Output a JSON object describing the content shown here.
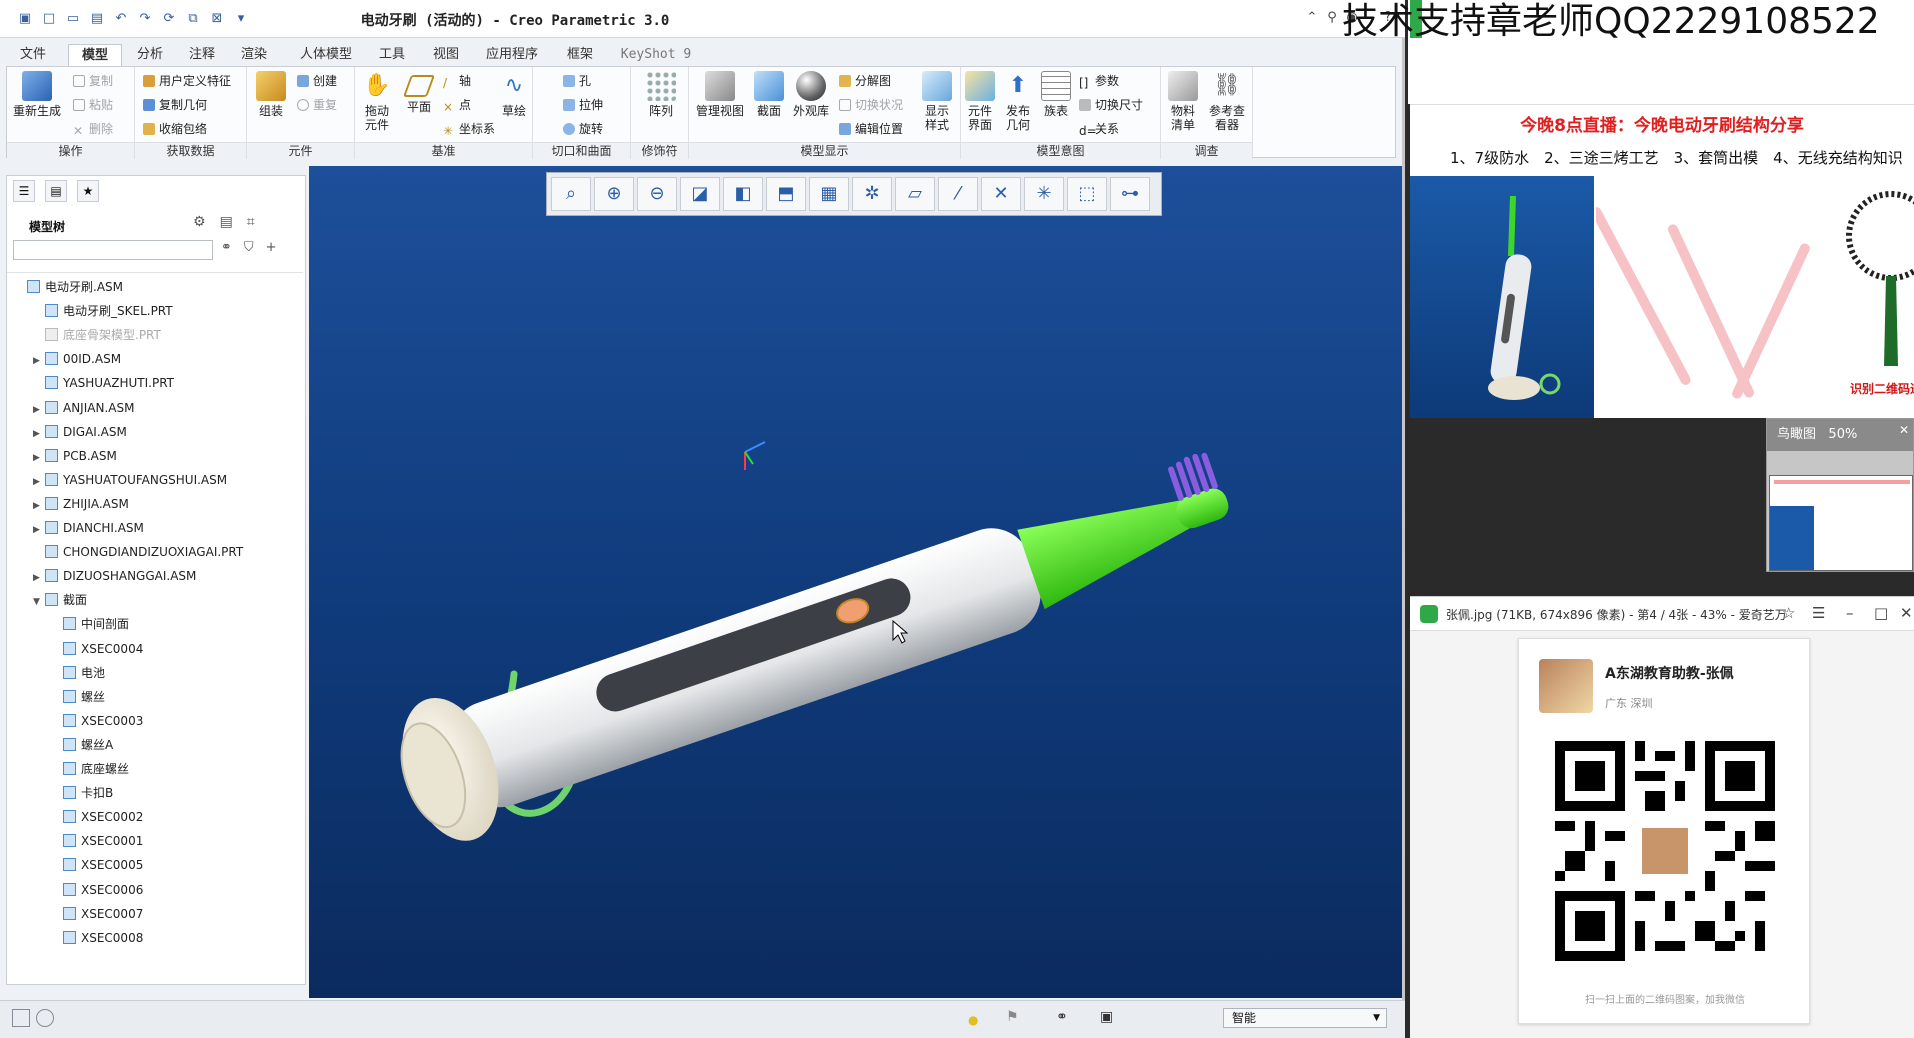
{
  "window": {
    "title": "电动牙刷 (活动的) - Creo Parametric 3.0"
  },
  "overlay": {
    "text": "技术支持章老师QQ2229108522"
  },
  "ribbon_tabs": [
    {
      "label": "文件"
    },
    {
      "label": "模型"
    },
    {
      "label": "分析"
    },
    {
      "label": "注释"
    },
    {
      "label": "渲染"
    },
    {
      "label": "人体模型"
    },
    {
      "label": "工具"
    },
    {
      "label": "视图"
    },
    {
      "label": "应用程序"
    },
    {
      "label": "框架"
    },
    {
      "label": "KeyShot 9"
    }
  ],
  "ribbon": {
    "operations": {
      "label": "操作",
      "regenerate": "重新生成",
      "copy": "复制",
      "paste": "粘贴",
      "delete": "删除"
    },
    "get_data": {
      "label": "获取数据",
      "udf": "用户定义特征",
      "copy_geom": "复制几何",
      "shrinkwrap": "收缩包络"
    },
    "component": {
      "label": "元件",
      "assemble": "组装",
      "create": "创建",
      "repeat": "重复"
    },
    "datum": {
      "label": "基准",
      "drag": "拖动元件",
      "plane": "平面",
      "axis": "轴",
      "point": "点",
      "csys": "坐标系",
      "sketch": "草绘"
    },
    "cut_surface": {
      "label": "切口和曲面",
      "hole": "孔",
      "extrude": "拉伸",
      "revolve": "旋转"
    },
    "modifiers": {
      "label": "修饰符",
      "pattern": "阵列"
    },
    "model_display": {
      "label": "模型显示",
      "manage_views": "管理视图",
      "section": "截面",
      "appearance": "外观库",
      "exploded": "分解图",
      "toggle_status": "切换状况",
      "edit_position": "编辑位置",
      "display_style": "显示样式"
    },
    "model_intent": {
      "label": "模型意图",
      "component_interface": "元件界面",
      "publish_geometry": "发布几何",
      "family_table": "族表",
      "parameters": "参数",
      "switch_dims": "切换尺寸",
      "relations": "关系"
    },
    "investigate": {
      "label": "调查",
      "bom": "物料清单",
      "reference_viewer": "参考查看器"
    }
  },
  "model_tree": {
    "header": "模型树",
    "nodes": [
      {
        "label": "电动牙刷.ASM",
        "level": 0,
        "toggle": "",
        "dim": false
      },
      {
        "label": "电动牙刷_SKEL.PRT",
        "level": 1,
        "toggle": "",
        "dim": false
      },
      {
        "label": "底座骨架模型.PRT",
        "level": 1,
        "toggle": "",
        "dim": true
      },
      {
        "label": "00ID.ASM",
        "level": 1,
        "toggle": "▶",
        "dim": false
      },
      {
        "label": "YASHUAZHUTI.PRT",
        "level": 1,
        "toggle": "",
        "dim": false
      },
      {
        "label": "ANJIAN.ASM",
        "level": 1,
        "toggle": "▶",
        "dim": false
      },
      {
        "label": "DIGAI.ASM",
        "level": 1,
        "toggle": "▶",
        "dim": false
      },
      {
        "label": "PCB.ASM",
        "level": 1,
        "toggle": "▶",
        "dim": false
      },
      {
        "label": "YASHUATOUFANGSHUI.ASM",
        "level": 1,
        "toggle": "▶",
        "dim": false
      },
      {
        "label": "ZHIJIA.ASM",
        "level": 1,
        "toggle": "▶",
        "dim": false
      },
      {
        "label": "DIANCHI.ASM",
        "level": 1,
        "toggle": "▶",
        "dim": false
      },
      {
        "label": "CHONGDIANDIZUOXIAGAI.PRT",
        "level": 1,
        "toggle": "",
        "dim": false
      },
      {
        "label": "DIZUOSHANGGAI.ASM",
        "level": 1,
        "toggle": "▶",
        "dim": false
      },
      {
        "label": "截面",
        "level": 1,
        "toggle": "▼",
        "dim": false
      },
      {
        "label": "中间剖面",
        "level": 2,
        "toggle": "",
        "dim": false
      },
      {
        "label": "XSEC0004",
        "level": 2,
        "toggle": "",
        "dim": false
      },
      {
        "label": "电池",
        "level": 2,
        "toggle": "",
        "dim": false
      },
      {
        "label": "螺丝",
        "level": 2,
        "toggle": "",
        "dim": false
      },
      {
        "label": "XSEC0003",
        "level": 2,
        "toggle": "",
        "dim": false
      },
      {
        "label": "螺丝A",
        "level": 2,
        "toggle": "",
        "dim": false
      },
      {
        "label": "底座螺丝",
        "level": 2,
        "toggle": "",
        "dim": false
      },
      {
        "label": "卡扣B",
        "level": 2,
        "toggle": "",
        "dim": false
      },
      {
        "label": "XSEC0002",
        "level": 2,
        "toggle": "",
        "dim": false
      },
      {
        "label": "XSEC0001",
        "level": 2,
        "toggle": "",
        "dim": false
      },
      {
        "label": "XSEC0005",
        "level": 2,
        "toggle": "",
        "dim": false
      },
      {
        "label": "XSEC0006",
        "level": 2,
        "toggle": "",
        "dim": false
      },
      {
        "label": "XSEC0007",
        "level": 2,
        "toggle": "",
        "dim": false
      },
      {
        "label": "XSEC0008",
        "level": 2,
        "toggle": "",
        "dim": false
      }
    ]
  },
  "status": {
    "filter": "智能"
  },
  "promo": {
    "title": "今晚8点直播：今晚电动牙刷结构分享",
    "points": "1、7级防水　2、三途三烤工艺　3、套筒出模　4、无线充结构知识",
    "scan_label": "识别二维码进"
  },
  "birdseye": {
    "title": "鸟瞰图",
    "zoom": "50%"
  },
  "viewer": {
    "title": "张佩.jpg (71KB, 674x896 像素) - 第4 / 4张 - 43% - 爱奇艺万",
    "card_name": "A东湖教育助教-张佩",
    "card_location": "广东 深圳",
    "card_footer": "扫一扫上面的二维码图案，加我微信"
  },
  "colors": {
    "viewport_top": "#1d4f9a",
    "viewport_bottom": "#0b2b5e",
    "brush_head": "#4ee01a",
    "bristles": "#8a5ce0",
    "cable": "#7fd67a",
    "promo_red": "#e02020"
  }
}
